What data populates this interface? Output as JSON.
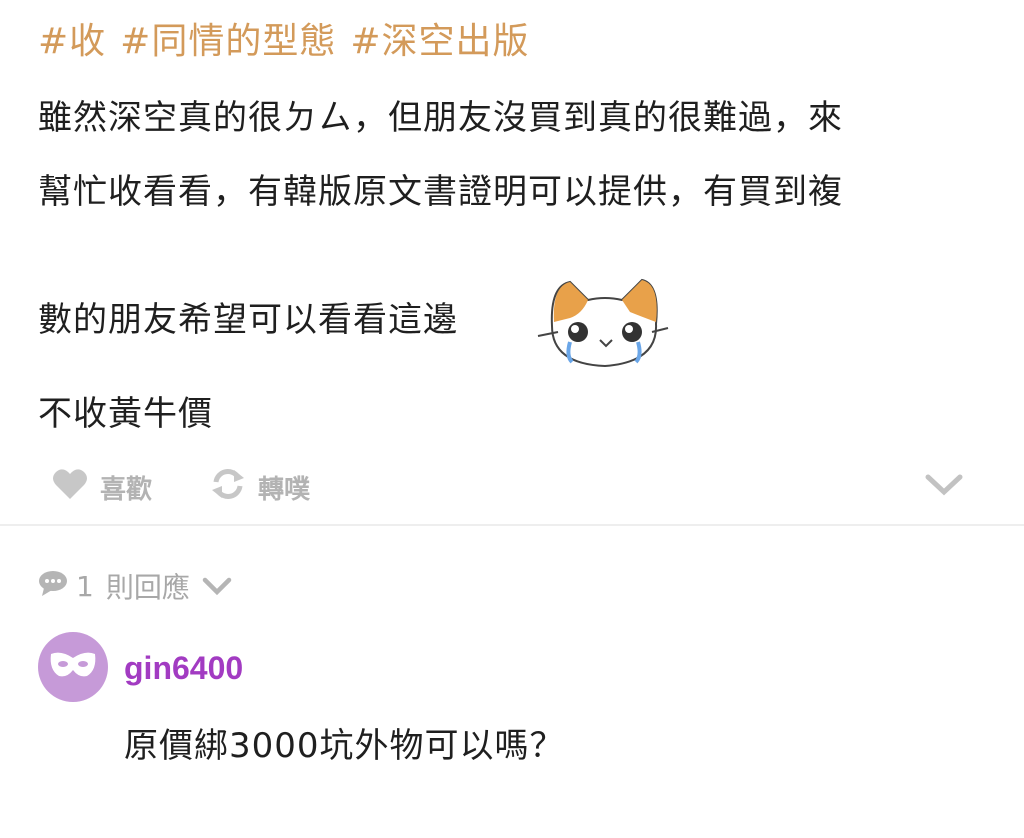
{
  "post": {
    "tags": [
      "#收",
      "#同情的型態",
      "#深空出版"
    ],
    "lines": [
      "雖然深空真的很ㄉㄙ，但朋友沒買到真的很難過，來",
      "幫忙收看看，有韓版原文書證明可以提供，有買到複",
      "數的朋友希望可以看看這邊",
      "不收黃牛價"
    ],
    "sticker_icon": "crying-cat-sticker"
  },
  "actions": {
    "like_label": "喜歡",
    "share_label": "轉噗",
    "like_icon": "heart-icon",
    "share_icon": "repost-icon",
    "expand_icon": "chevron-down-icon"
  },
  "replies": {
    "count": "1",
    "label": "則回應",
    "icon": "comment-bubble-icon"
  },
  "comment": {
    "username": "gin6400",
    "text": "原價綁3000坑外物可以嗎？",
    "avatar_icon": "mask-icon",
    "colors": {
      "avatar_bg": "#c69ad8",
      "username": "#a23bc2"
    }
  },
  "colors": {
    "tag": "#d39a5a",
    "muted": "#b3b3b3"
  }
}
